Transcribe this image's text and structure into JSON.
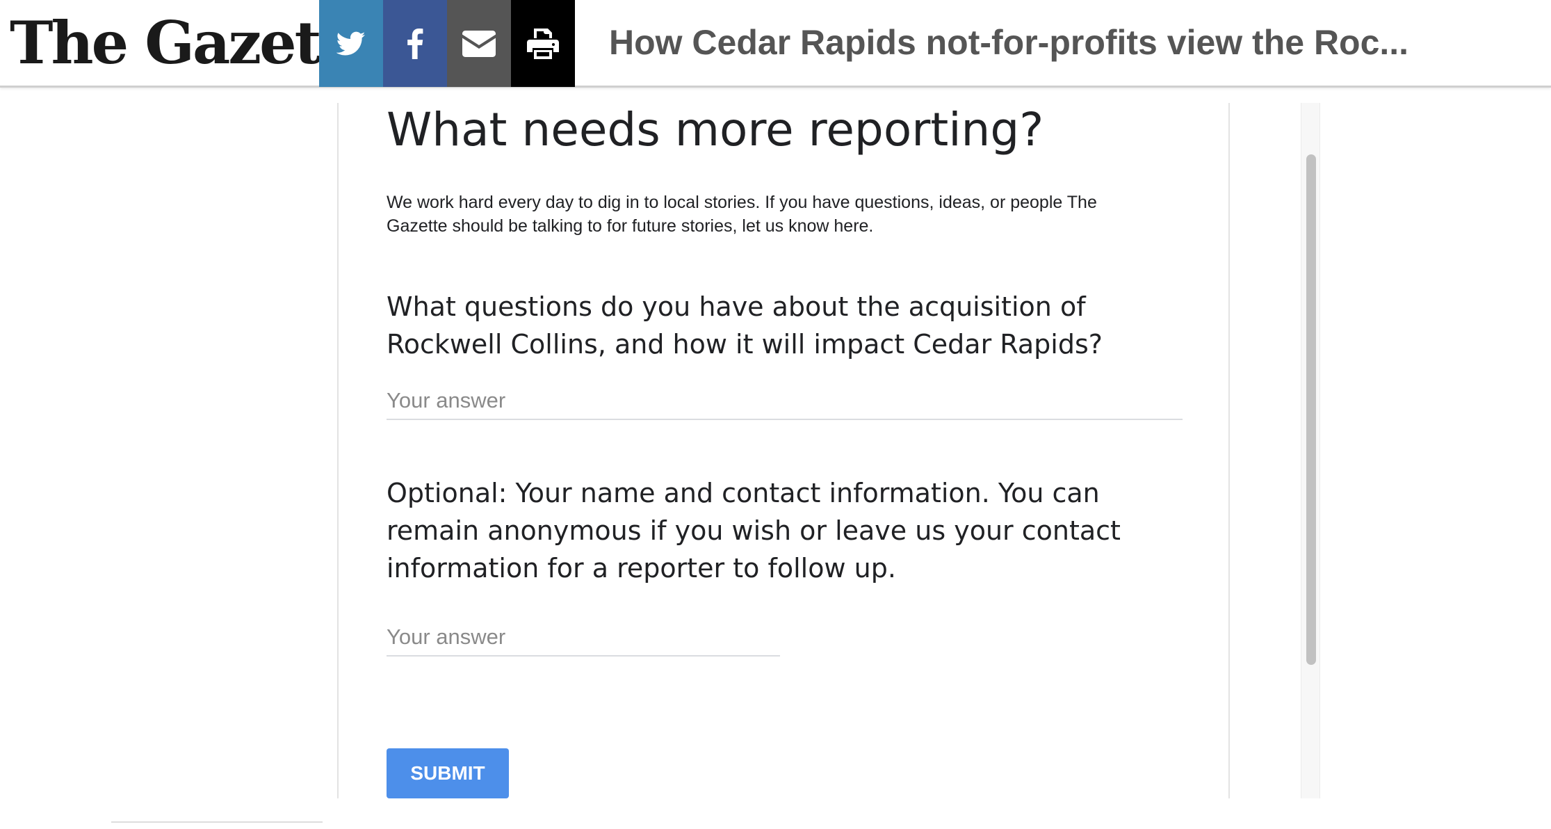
{
  "header": {
    "logo_text": "The Gazette",
    "headline": "How Cedar Rapids not-for-profits view the Roc...",
    "share_buttons": [
      {
        "name": "twitter",
        "icon": "twitter-icon",
        "color": "#3a84b4"
      },
      {
        "name": "facebook",
        "icon": "facebook-icon",
        "color": "#3b5795"
      },
      {
        "name": "email",
        "icon": "envelope-icon",
        "color": "#555555"
      },
      {
        "name": "print",
        "icon": "printer-icon",
        "color": "#000000"
      }
    ]
  },
  "form": {
    "title": "What needs more reporting?",
    "description": "We work hard every day to dig in to local stories. If you have questions, ideas, or people The Gazette should be talking to for future stories, let us know here.",
    "questions": [
      {
        "label": "What questions do you have about the acquisition of Rockwell Collins, and how it will impact Cedar Rapids?",
        "placeholder": "Your answer",
        "value": ""
      },
      {
        "label": "Optional: Your name and contact information. You can remain anonymous if you wish or leave us your contact information for a reporter to follow up.",
        "placeholder": "Your answer",
        "value": ""
      }
    ],
    "submit_label": "SUBMIT",
    "submit_color": "#4d8fea"
  }
}
